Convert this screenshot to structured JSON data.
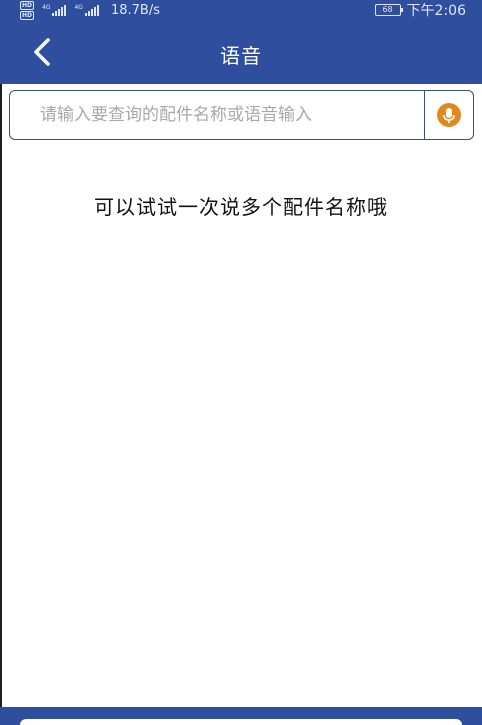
{
  "status_bar": {
    "hd_top": "HD",
    "hd_bottom": "HD",
    "net1_tag": "4G",
    "net2_tag": "4G",
    "net_speed": "18.7B/s",
    "battery_level": "68",
    "time": "下午2:06"
  },
  "header": {
    "title": "语音",
    "back_icon": "chevron-left-icon"
  },
  "search": {
    "placeholder": "请输入要查询的配件名称或语音输入",
    "value": "",
    "mic_icon": "microphone-icon"
  },
  "main": {
    "hint": "可以试试一次说多个配件名称哦"
  },
  "colors": {
    "primary": "#2f4f9e",
    "mic_accent": "#e08a1e",
    "border": "#3b4f7a"
  }
}
